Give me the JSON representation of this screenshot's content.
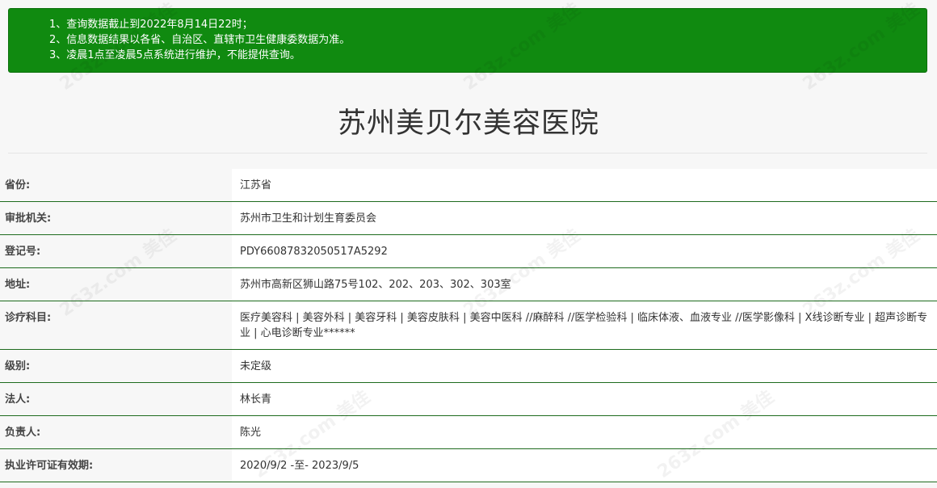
{
  "notice": {
    "lines": [
      "1、查询数据截止到2022年8月14日22时；",
      "2、信息数据结果以各省、自治区、直辖市卫生健康委数据为准。",
      "3、凌晨1点至凌晨5点系统进行维护，不能提供查询。"
    ]
  },
  "title": "苏州美贝尔美容医院",
  "rows": [
    {
      "label": "省份:",
      "value": "江苏省"
    },
    {
      "label": "审批机关:",
      "value": "苏州市卫生和计划生育委员会"
    },
    {
      "label": "登记号:",
      "value": "PDY66087832050517A5292"
    },
    {
      "label": "地址:",
      "value": "苏州市高新区狮山路75号102、202、203、302、303室"
    },
    {
      "label": "诊疗科目:",
      "value": "医疗美容科 | 美容外科 | 美容牙科 | 美容皮肤科 | 美容中医科 //麻醉科 //医学检验科 | 临床体液、血液专业 //医学影像科 | X线诊断专业 | 超声诊断专业 | 心电诊断专业******"
    },
    {
      "label": "级别:",
      "value": "未定级"
    },
    {
      "label": "法人:",
      "value": "林长青"
    },
    {
      "label": "负责人:",
      "value": "陈光"
    },
    {
      "label": "执业许可证有效期:",
      "value": "2020/9/2 -至- 2023/9/5"
    }
  ],
  "watermark": {
    "text": "263z.com 美佳"
  },
  "colors": {
    "notice_bg": "#108a10",
    "row_border": "#1e6b1e",
    "page_bg": "#f7f7f7"
  }
}
